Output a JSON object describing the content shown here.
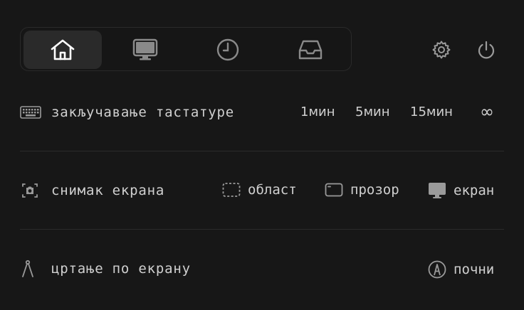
{
  "tabs": [
    {
      "icon": "home-icon",
      "active": true
    },
    {
      "icon": "monitor-icon",
      "active": false
    },
    {
      "icon": "clock-icon",
      "active": false
    },
    {
      "icon": "inbox-icon",
      "active": false
    }
  ],
  "top_right": {
    "settings_icon": "gear-icon",
    "power_icon": "power-icon"
  },
  "keyboard_lock": {
    "icon": "keyboard-icon",
    "label": "закључавање тастатуре",
    "options": [
      "1мин",
      "5мин",
      "15мин",
      "∞"
    ]
  },
  "screenshot": {
    "icon": "camera-icon",
    "label": "снимак екрана",
    "options": [
      {
        "icon": "dashed-rectangle-icon",
        "label": "област"
      },
      {
        "icon": "window-icon",
        "label": "прозор"
      },
      {
        "icon": "display-icon",
        "label": "екран"
      }
    ]
  },
  "draw": {
    "icon": "compass-icon",
    "label": "цртање по екрану",
    "action": {
      "icon": "pen-circle-icon",
      "label": "почни"
    }
  },
  "colors": {
    "background": "#171717",
    "text": "#d0d0d0",
    "active_tab": "#2a2a2a",
    "divider": "#2b2b2b"
  }
}
